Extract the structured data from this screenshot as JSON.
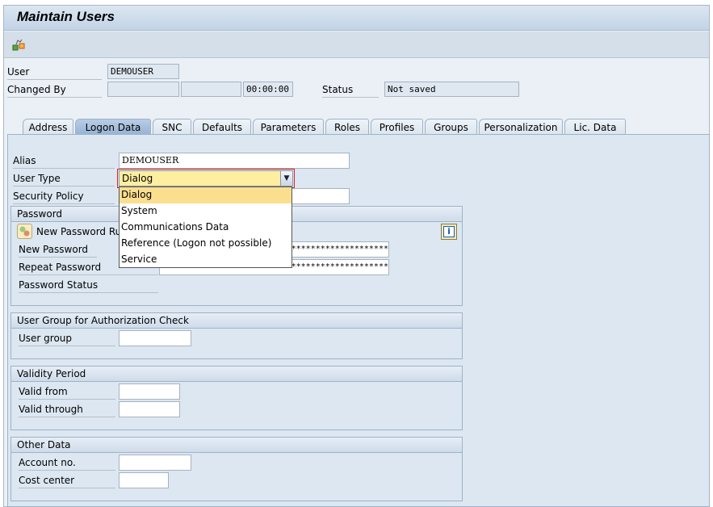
{
  "title": "Maintain Users",
  "toolbar": {
    "icon": "other-hierarchy-icon"
  },
  "header": {
    "user_label": "User",
    "user_value": "DEMOUSER",
    "changed_by_label": "Changed By",
    "changed_by_value": "",
    "changed_date": "",
    "changed_time": "00:00:00",
    "status_label": "Status",
    "status_value": "Not saved"
  },
  "tabs": [
    "Address",
    "Logon Data",
    "SNC",
    "Defaults",
    "Parameters",
    "Roles",
    "Profiles",
    "Groups",
    "Personalization",
    "Lic. Data"
  ],
  "active_tab": "Logon Data",
  "logon": {
    "alias_label": "Alias",
    "alias_value": "DEMOUSER",
    "user_type_label": "User Type",
    "user_type_value": "Dialog",
    "security_policy_label": "Security Policy",
    "security_policy_value": "",
    "user_type_options": [
      "Dialog",
      "System",
      "Communications Data",
      "Reference (Logon not possible)",
      "Service"
    ]
  },
  "password": {
    "title": "Password",
    "rule_button": "New Password Rule",
    "new_label": "New Password",
    "new_value": "**************************************",
    "repeat_label": "Repeat Password",
    "repeat_value": "**************************************",
    "status_label": "Password Status"
  },
  "auth_group": {
    "title": "User Group for Authorization Check",
    "label": "User group",
    "value": ""
  },
  "validity": {
    "title": "Validity Period",
    "from_label": "Valid from",
    "from_value": "",
    "through_label": "Valid through",
    "through_value": ""
  },
  "other": {
    "title": "Other Data",
    "account_label": "Account no.",
    "account_value": "",
    "cost_label": "Cost center",
    "cost_value": ""
  }
}
